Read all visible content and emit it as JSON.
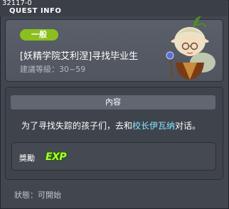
{
  "window": {
    "quest_id": "32117-0",
    "title": "QUEST INFO"
  },
  "header": {
    "category": "一般",
    "quest_name": "[妖精学院艾利涅]寻找毕业生",
    "level_line": "建議等級：30~59",
    "npc_icon": "elf-elder-portrait"
  },
  "content": {
    "section_title": "內容",
    "description_prefix": "为了寻找失踪的孩子们，去和",
    "npc_name": "校长伊瓦纳",
    "description_suffix": "对话。"
  },
  "reward": {
    "label": "獎勵",
    "exp_label": "EXP"
  },
  "status": {
    "text": "狀態：可開始"
  },
  "colors": {
    "badge": "#8bbf1e",
    "npc_link": "#84e6ff",
    "exp": "#a8ff33"
  }
}
